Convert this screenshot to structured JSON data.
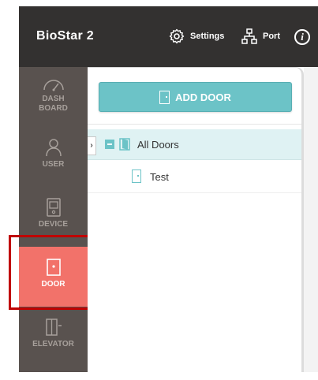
{
  "header": {
    "app_title": "BioStar 2",
    "settings_label": "Settings",
    "port_label": "Port",
    "info_symbol": "i"
  },
  "sidebar": {
    "items": [
      {
        "label": "DASH\nBOARD",
        "icon": "gauge-icon"
      },
      {
        "label": "USER",
        "icon": "user-icon"
      },
      {
        "label": "DEVICE",
        "icon": "device-icon"
      },
      {
        "label": "DOOR",
        "icon": "door-icon",
        "active": true
      },
      {
        "label": "ELEVATOR",
        "icon": "elevator-icon"
      }
    ]
  },
  "main": {
    "add_door_label": "ADD DOOR",
    "tree": {
      "toggle_symbol": "›",
      "root_label": "All Doors",
      "children": [
        {
          "label": "Test"
        }
      ]
    }
  },
  "colors": {
    "accent": "#6cc3c7",
    "active_nav": "#f2726a",
    "sidebar_bg": "#59524f",
    "topbar_bg": "#333130",
    "highlight": "#c00000"
  }
}
